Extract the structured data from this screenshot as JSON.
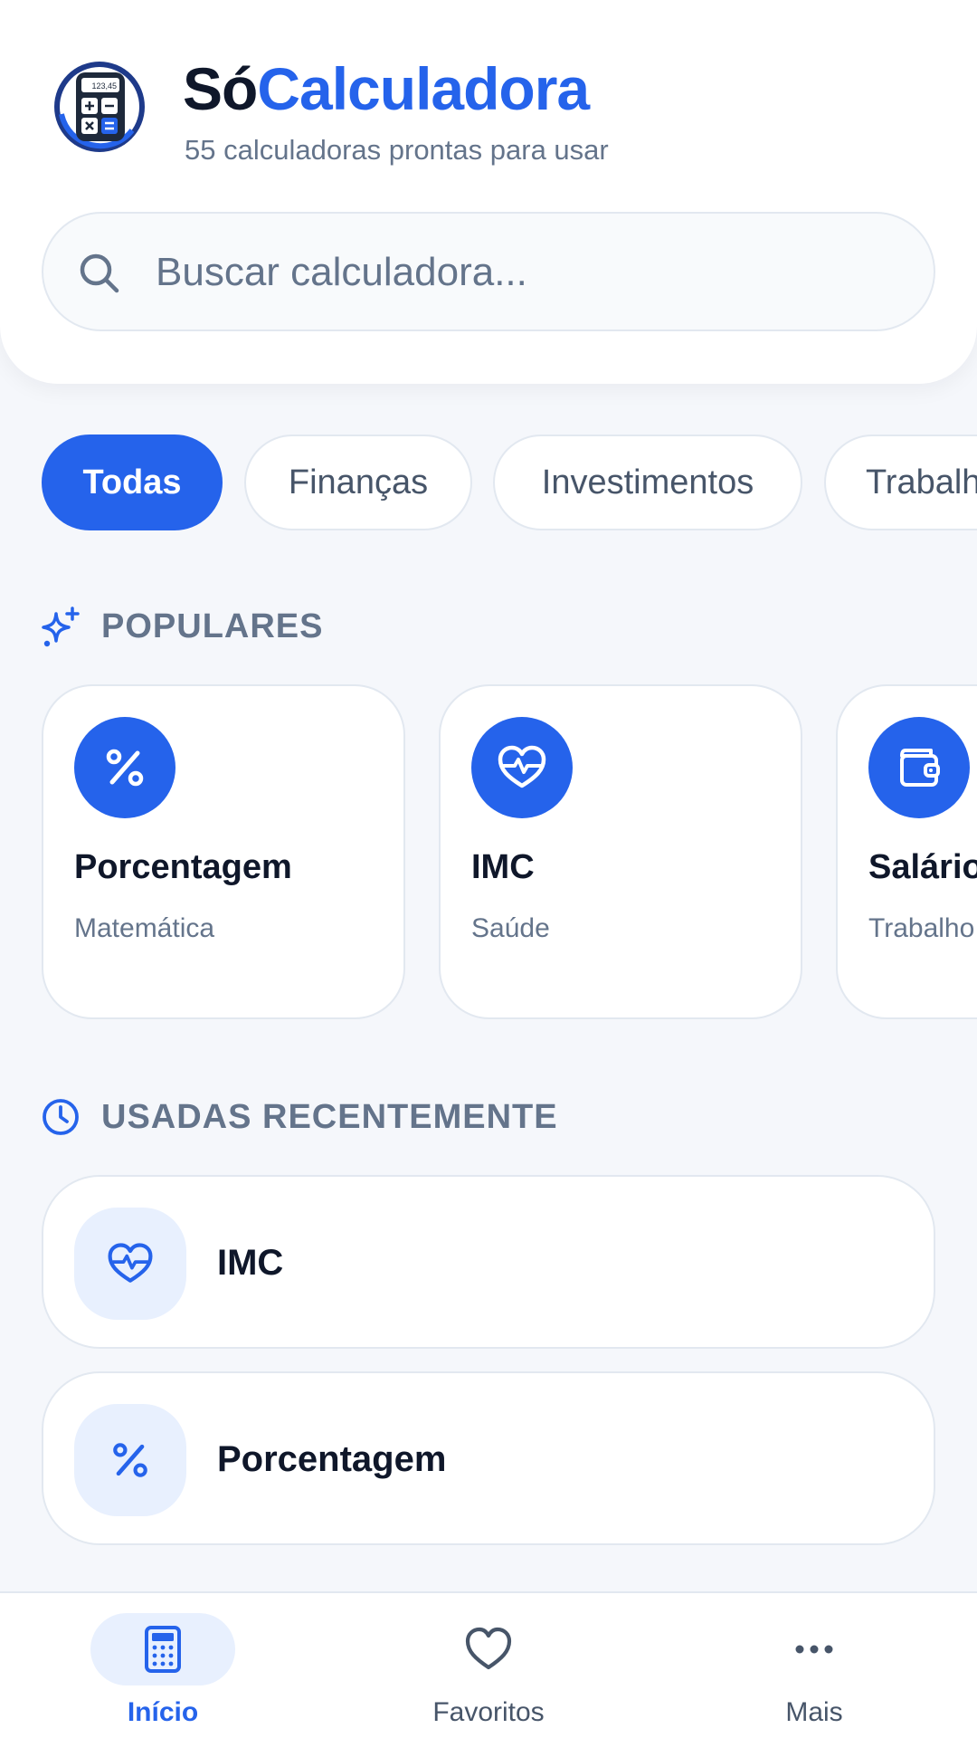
{
  "header": {
    "brand_part1": "Só",
    "brand_part2": "Calculadora",
    "subtitle": "55 calculadoras prontas para usar",
    "logo_icon": "calculator-logo-icon",
    "logo_display": "123,45"
  },
  "search": {
    "placeholder": "Buscar calculadora...",
    "value": "",
    "icon": "search-icon"
  },
  "categories": {
    "items": [
      {
        "label": "Todas",
        "active": true
      },
      {
        "label": "Finanças",
        "active": false
      },
      {
        "label": "Investimentos",
        "active": false
      },
      {
        "label": "Trabalho",
        "active": false
      }
    ]
  },
  "popular": {
    "title": "POPULARES",
    "icon": "sparkles-icon",
    "cards": [
      {
        "name": "Porcentagem",
        "category": "Matemática",
        "icon": "percent-icon"
      },
      {
        "name": "IMC",
        "category": "Saúde",
        "icon": "heart-pulse-icon"
      },
      {
        "name": "Salário",
        "category": "Trabalho",
        "icon": "wallet-icon"
      }
    ]
  },
  "recent": {
    "title": "USADAS RECENTEMENTE",
    "icon": "clock-icon",
    "items": [
      {
        "label": "IMC",
        "icon": "heart-pulse-icon"
      },
      {
        "label": "Porcentagem",
        "icon": "percent-icon"
      }
    ]
  },
  "nav": {
    "items": [
      {
        "label": "Início",
        "icon": "calculator-icon",
        "active": true
      },
      {
        "label": "Favoritos",
        "icon": "heart-icon",
        "active": false
      },
      {
        "label": "Mais",
        "icon": "more-dots-icon",
        "active": false
      }
    ]
  },
  "colors": {
    "accent": "#2563eb",
    "accent_soft": "#e8f0fe",
    "background": "#f5f7fb",
    "text_primary": "#0f172a",
    "text_secondary": "#64748b"
  }
}
